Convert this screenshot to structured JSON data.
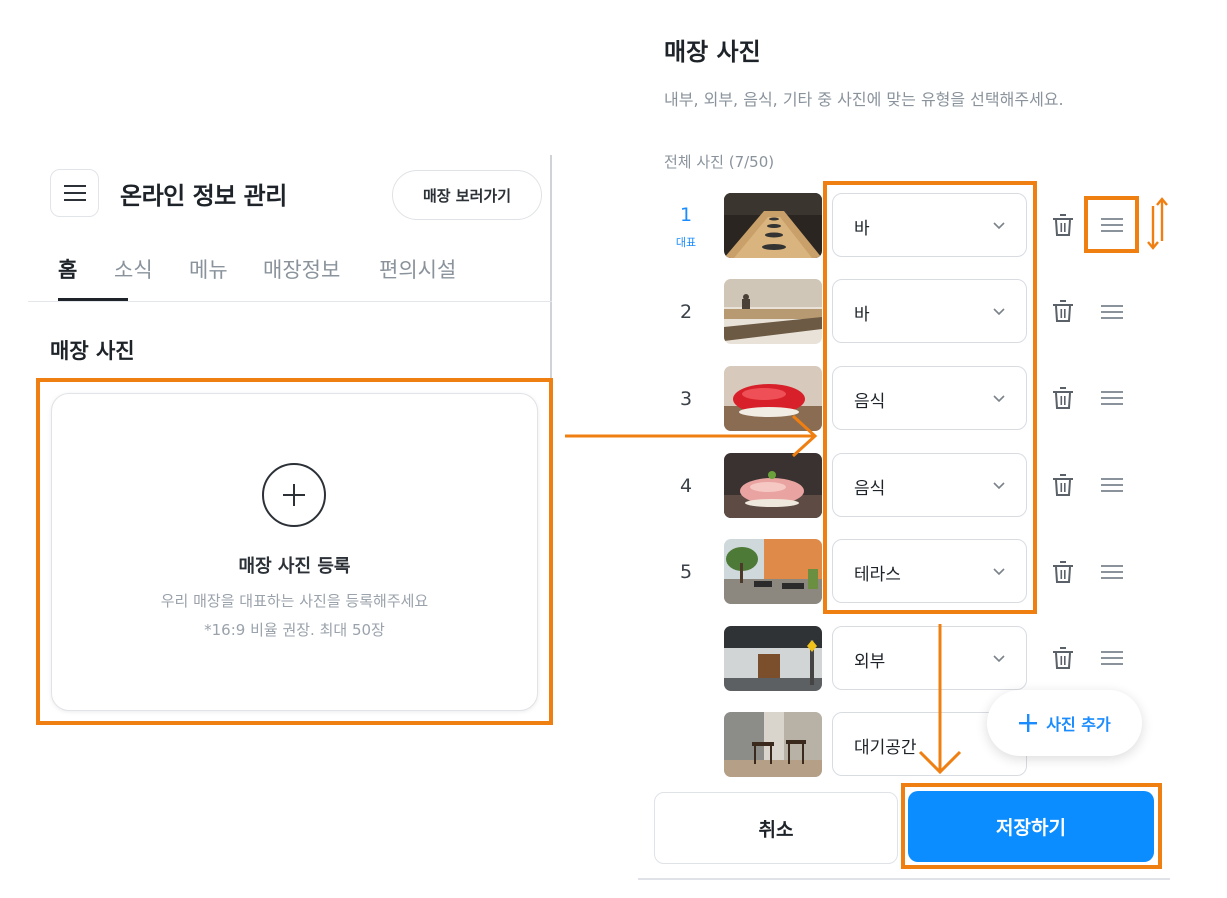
{
  "left": {
    "header": {
      "title": "온라인 정보 관리",
      "view_store_label": "매장 보러가기"
    },
    "tabs": [
      {
        "label": "홈",
        "active": true
      },
      {
        "label": "소식",
        "active": false
      },
      {
        "label": "메뉴",
        "active": false
      },
      {
        "label": "매장정보",
        "active": false
      },
      {
        "label": "편의시설",
        "active": false
      }
    ],
    "section_title": "매장 사진",
    "upload": {
      "title": "매장 사진 등록",
      "description": "우리 매장을 대표하는 사진을 등록해주세요",
      "note": "*16:9 비율 권장. 최대 50장"
    }
  },
  "right": {
    "title": "매장 사진",
    "subtitle": "내부, 외부, 음식, 기타 중 사진에 맞는 유형을 선택해주세요.",
    "count_label": "전체 사진 (7/50)",
    "representative_label": "대표",
    "photos": [
      {
        "number": "1",
        "category": "바",
        "thumb": "bar-counter"
      },
      {
        "number": "2",
        "category": "바",
        "thumb": "dining-room"
      },
      {
        "number": "3",
        "category": "음식",
        "thumb": "tuna-sushi"
      },
      {
        "number": "4",
        "category": "음식",
        "thumb": "fatty-tuna-sushi"
      },
      {
        "number": "5",
        "category": "테라스",
        "thumb": "terrace"
      },
      {
        "number": "",
        "category": "외부",
        "thumb": "exterior"
      },
      {
        "number": "",
        "category": "대기공간",
        "thumb": "waiting-area"
      }
    ],
    "add_photo_label": "사진 추가",
    "cancel_label": "취소",
    "save_label": "저장하기"
  },
  "colors": {
    "accent_blue": "#0b8cff",
    "highlight_orange": "#f07f12",
    "text_dark": "#1d2329",
    "text_muted": "#8a939c"
  },
  "icons": [
    "hamburger-icon",
    "plus-icon",
    "chevron-down-icon",
    "trash-icon",
    "drag-handle-icon",
    "reorder-arrows-icon"
  ]
}
